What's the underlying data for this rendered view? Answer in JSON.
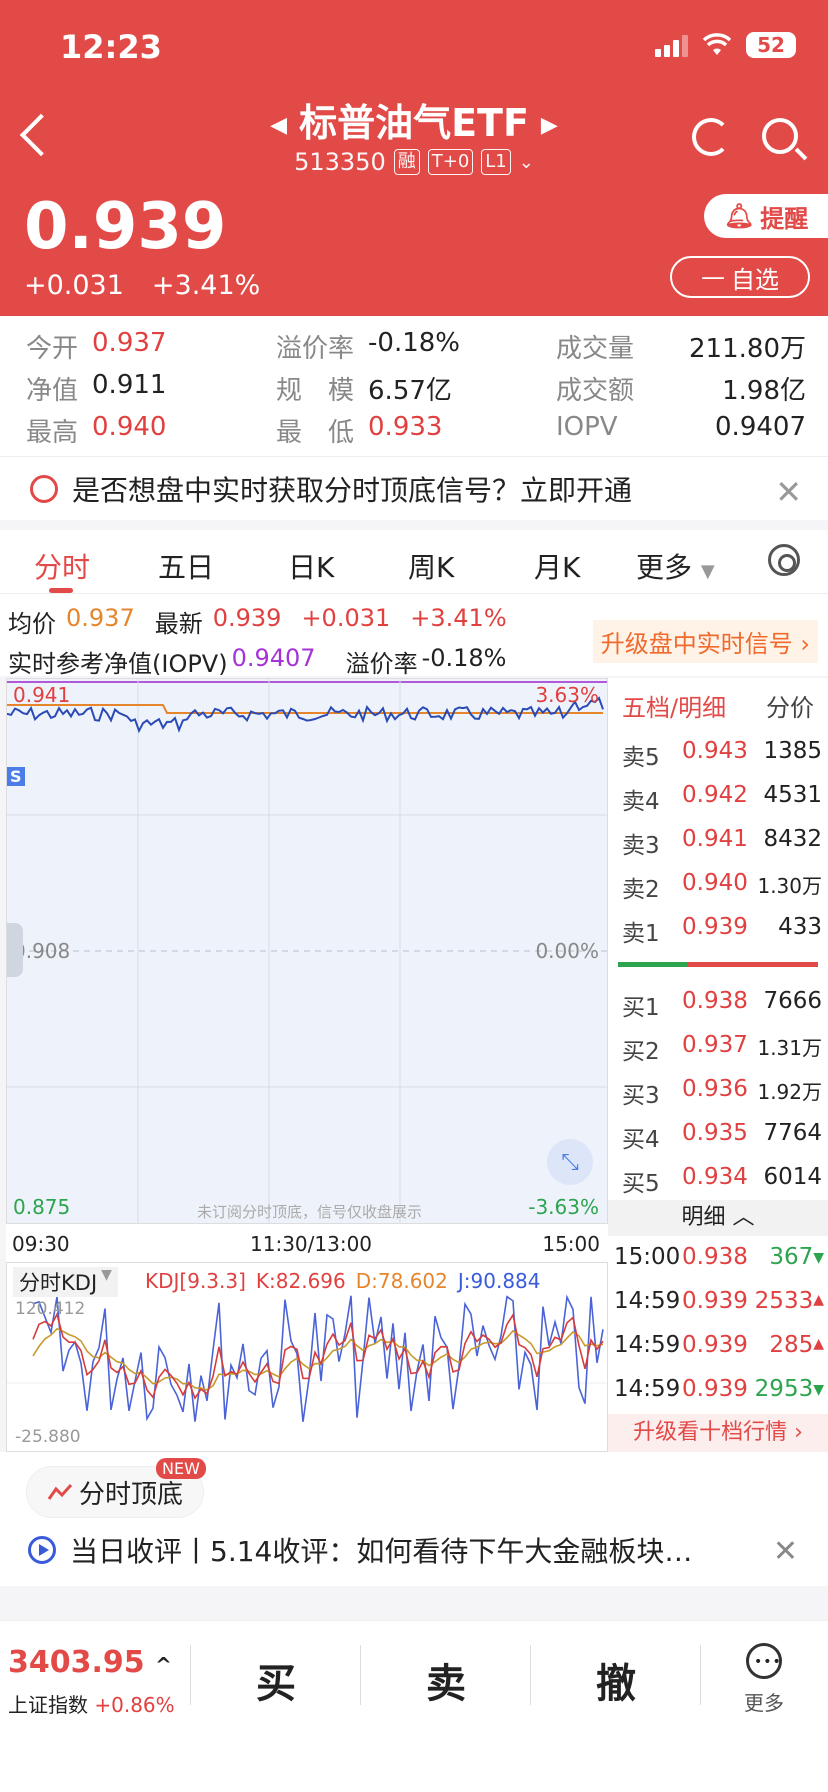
{
  "status_bar": {
    "time": "12:23",
    "battery": "52"
  },
  "header": {
    "title": "标普油气ETF",
    "code": "513350",
    "tags": [
      "融",
      "T+0",
      "L1"
    ],
    "price": "0.939",
    "change": "+0.031",
    "change_pct": "+3.41%",
    "alert_label": "提醒",
    "fav_label": "自选"
  },
  "stats": {
    "open_label": "今开",
    "open": "0.937",
    "premium_label": "溢价率",
    "premium": "-0.18%",
    "volume_label": "成交量",
    "volume": "211.80万",
    "nav_label": "净值",
    "nav": "0.911",
    "scale_label": "规　模",
    "scale": "6.57亿",
    "turnover_label": "成交额",
    "turnover": "1.98亿",
    "high_label": "最高",
    "high": "0.940",
    "low_label": "最　低",
    "low": "0.933",
    "iopv_label": "IOPV",
    "iopv": "0.9407"
  },
  "promo": {
    "text": "是否想盘中实时获取分时顶底信号？立即开通"
  },
  "tabs": [
    "分时",
    "五日",
    "日K",
    "周K",
    "月K",
    "更多"
  ],
  "info": {
    "avg_label": "均价",
    "avg": "0.937",
    "latest_label": "最新",
    "latest": "0.939",
    "change": "+0.031",
    "change_pct": "+3.41%",
    "iopv_label": "实时参考净值(IOPV)",
    "iopv": "0.9407",
    "premium_label": "溢价率",
    "premium": "-0.18%",
    "upgrade_label": "升级盘中实时信号"
  },
  "chart": {
    "top_price": "0.941",
    "top_pct": "3.63%",
    "mid_price": "0.908",
    "mid_pct": "0.00%",
    "bottom_price": "0.875",
    "bottom_pct": "-3.63%",
    "s_label": "S",
    "note": "未订阅分时顶底，信号仅收盘展示",
    "times": [
      "09:30",
      "11:30/13:00",
      "15:00"
    ],
    "colors": {
      "price_line": "#2a4bb5",
      "avg_line": "#e6862c",
      "background": "#eef3fb"
    }
  },
  "kdj": {
    "selector": "分时KDJ",
    "params": "KDJ[9.3.3]",
    "k": "K:82.696",
    "d": "D:78.602",
    "j": "J:90.884",
    "top": "120.412",
    "bottom": "-25.880"
  },
  "orderbook": {
    "header_left": "五档/明细",
    "header_right": "分价",
    "asks": [
      {
        "name": "卖5",
        "price": "0.943",
        "qty": "1385"
      },
      {
        "name": "卖4",
        "price": "0.942",
        "qty": "4531"
      },
      {
        "name": "卖3",
        "price": "0.941",
        "qty": "8432"
      },
      {
        "name": "卖2",
        "price": "0.940",
        "qty": "1.30万"
      },
      {
        "name": "卖1",
        "price": "0.939",
        "qty": "433"
      }
    ],
    "bids": [
      {
        "name": "买1",
        "price": "0.938",
        "qty": "7666"
      },
      {
        "name": "买2",
        "price": "0.937",
        "qty": "1.31万"
      },
      {
        "name": "买3",
        "price": "0.936",
        "qty": "1.92万"
      },
      {
        "name": "买4",
        "price": "0.935",
        "qty": "7764"
      },
      {
        "name": "买5",
        "price": "0.934",
        "qty": "6014"
      }
    ],
    "detail_label": "明细",
    "trades": [
      {
        "time": "15:00",
        "price": "0.938",
        "qty": "367",
        "dir": "down"
      },
      {
        "time": "14:59",
        "price": "0.939",
        "qty": "2533",
        "dir": "up"
      },
      {
        "time": "14:59",
        "price": "0.939",
        "qty": "285",
        "dir": "up"
      },
      {
        "time": "14:59",
        "price": "0.939",
        "qty": "2953",
        "dir": "down"
      }
    ],
    "upgrade_label": "升级看十档行情"
  },
  "signal_pill": {
    "label": "分时顶底",
    "badge": "NEW"
  },
  "news": {
    "text": "当日收评丨5.14收评：如何看待下午大金融板块…"
  },
  "footer": {
    "index_value": "3403.95",
    "index_name": "上证指数",
    "index_change": "+0.86%",
    "buy": "买",
    "sell": "卖",
    "cancel": "撤",
    "more": "更多"
  }
}
